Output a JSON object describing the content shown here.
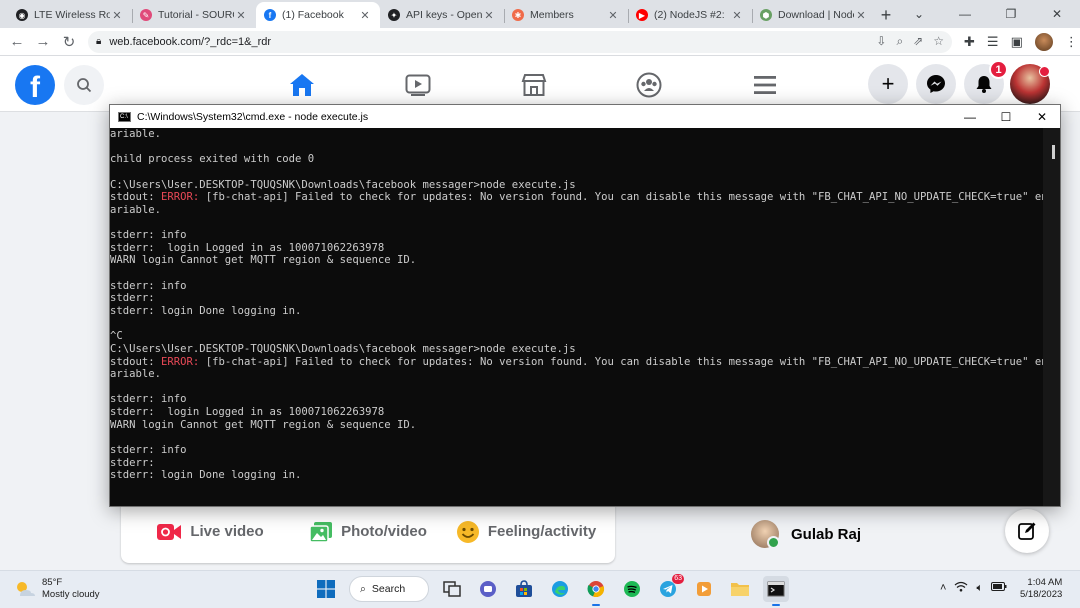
{
  "browser": {
    "tabs": [
      {
        "title": "LTE Wireless Rou",
        "color": "#202124",
        "glyph": "◉"
      },
      {
        "title": "Tutorial - SOURC",
        "color": "#e04a7a",
        "glyph": "✎"
      },
      {
        "title": "(1) Facebook",
        "color": "#1877f2",
        "glyph": "f",
        "active": true
      },
      {
        "title": "API keys - Open",
        "color": "#202124",
        "glyph": "✦"
      },
      {
        "title": "Members",
        "color": "#f06b4a",
        "glyph": "✱"
      },
      {
        "title": "(2) NodeJS #2:",
        "color": "#ff0000",
        "glyph": "▶"
      },
      {
        "title": "Download | Node",
        "color": "#68a063",
        "glyph": "⬢"
      }
    ],
    "url": "web.facebook.com/?_rdc=1&_rdr"
  },
  "facebook": {
    "notification_count": "1",
    "composer": {
      "live_video": "Live video",
      "photo_video": "Photo/video",
      "feeling_activity": "Feeling/activity"
    },
    "contact_name": "Gulab Raj"
  },
  "cmd": {
    "title": "C:\\Windows\\System32\\cmd.exe - node  execute.js",
    "lines": [
      [
        {
          "t": "ariable."
        }
      ],
      [],
      [
        {
          "t": "child process exited with code 0"
        }
      ],
      [],
      [
        {
          "t": "C:\\Users\\User.DESKTOP-TQUQSNK\\Downloads\\facebook messager>node execute.js"
        }
      ],
      [
        {
          "t": "stdout: "
        },
        {
          "t": "ERROR:",
          "err": true
        },
        {
          "t": " [fb-chat-api] Failed to check for updates: No version found. You can disable this message with \"FB_CHAT_API_NO_UPDATE_CHECK=true\" env v"
        }
      ],
      [
        {
          "t": "ariable."
        }
      ],
      [],
      [
        {
          "t": "stderr: info"
        }
      ],
      [
        {
          "t": "stderr:  login Logged in as 100071062263978"
        }
      ],
      [
        {
          "t": "WARN login Cannot get MQTT region & sequence ID."
        }
      ],
      [],
      [
        {
          "t": "stderr: info"
        }
      ],
      [
        {
          "t": "stderr:"
        }
      ],
      [
        {
          "t": "stderr: login Done logging in."
        }
      ],
      [],
      [
        {
          "t": "^C"
        }
      ],
      [
        {
          "t": "C:\\Users\\User.DESKTOP-TQUQSNK\\Downloads\\facebook messager>node execute.js"
        }
      ],
      [
        {
          "t": "stdout: "
        },
        {
          "t": "ERROR:",
          "err": true
        },
        {
          "t": " [fb-chat-api] Failed to check for updates: No version found. You can disable this message with \"FB_CHAT_API_NO_UPDATE_CHECK=true\" env v"
        }
      ],
      [
        {
          "t": "ariable."
        }
      ],
      [],
      [
        {
          "t": "stderr: info"
        }
      ],
      [
        {
          "t": "stderr:  login Logged in as 100071062263978"
        }
      ],
      [
        {
          "t": "WARN login Cannot get MQTT region & sequence ID."
        }
      ],
      [],
      [
        {
          "t": "stderr: info"
        }
      ],
      [
        {
          "t": "stderr:"
        }
      ],
      [
        {
          "t": "stderr: login Done logging in."
        }
      ]
    ]
  },
  "taskbar": {
    "temperature": "85°F",
    "weather": "Mostly cloudy",
    "search_label": "Search",
    "telegram_badge": "63",
    "time": "1:04 AM",
    "date": "5/18/2023"
  },
  "colors": {
    "facebook_blue": "#1877f2",
    "error_red": "#e74856",
    "console_text": "#cccccc"
  }
}
